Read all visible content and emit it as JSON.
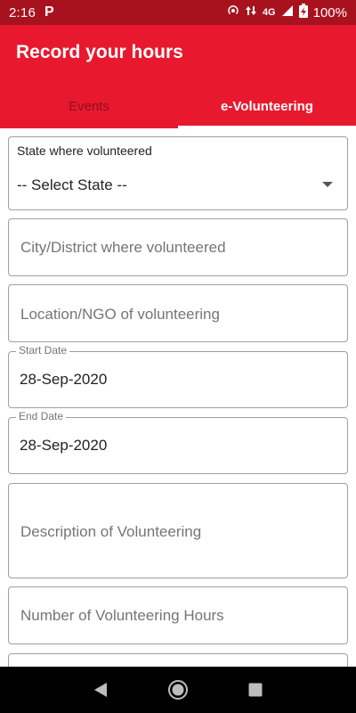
{
  "status_bar": {
    "time": "2:16",
    "notification_icon": "P",
    "network": "4G",
    "battery": "100%"
  },
  "app_bar": {
    "title": "Record your hours",
    "tabs": [
      {
        "label": "Events",
        "active": false
      },
      {
        "label": "e-Volunteering",
        "active": true
      }
    ]
  },
  "form": {
    "state": {
      "label": "State where volunteered",
      "value": "-- Select State --"
    },
    "city": {
      "placeholder": "City/District where volunteered"
    },
    "location": {
      "placeholder": "Location/NGO of volunteering"
    },
    "start_date": {
      "label": "Start Date",
      "value": "28-Sep-2020"
    },
    "end_date": {
      "label": "End Date",
      "value": "28-Sep-2020"
    },
    "description": {
      "placeholder": "Description of Volunteering"
    },
    "hours": {
      "placeholder": "Number of Volunteering Hours"
    }
  },
  "nav_bar": {
    "icons": [
      "back-icon",
      "home-icon",
      "recents-icon"
    ]
  },
  "colors": {
    "status_bar": "#a8121f",
    "app_bar": "#e8192e",
    "inactive_tab": "#8d0f1b"
  }
}
